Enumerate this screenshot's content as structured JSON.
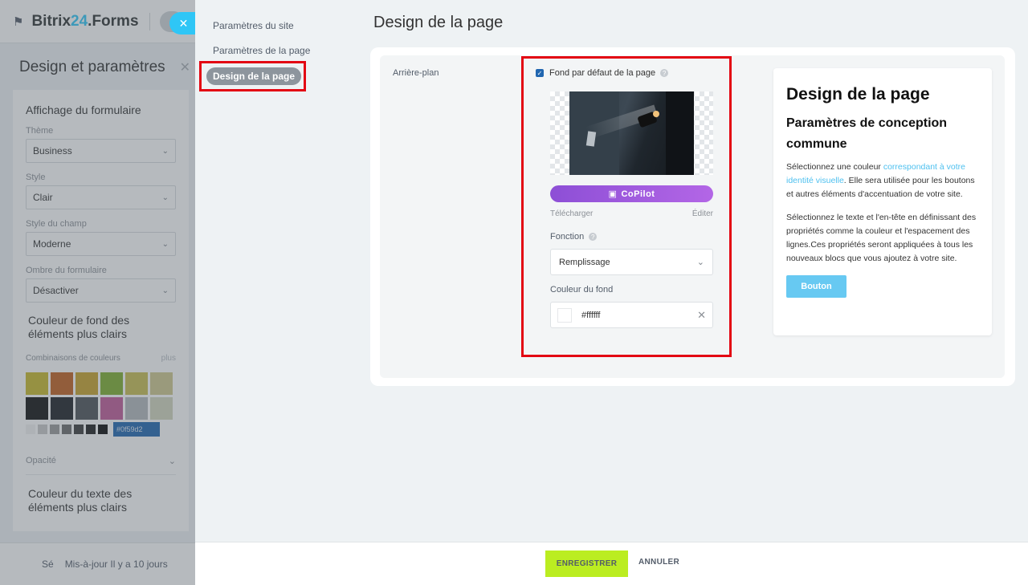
{
  "background": {
    "app_title_prefix": "Bitrix",
    "app_title_num": "24",
    "app_title_suffix": ".Forms",
    "panel_title": "Design et paramètres",
    "section_display": "Affichage du formulaire",
    "theme_label": "Thème",
    "theme_value": "Business",
    "style_label": "Style",
    "style_value": "Clair",
    "field_style_label": "Style du champ",
    "field_style_value": "Moderne",
    "shadow_label": "Ombre du formulaire",
    "shadow_value": "Désactiver",
    "bg_color_title": "Couleur de fond des éléments plus clairs",
    "combos_label": "Combinaisons de couleurs",
    "combos_plus": "plus",
    "swatch_colors": [
      "#c9b82a",
      "#c25f1e",
      "#c9a32a",
      "#7fae2e",
      "#c9be52",
      "#cfc98e",
      "#111111",
      "#1d2025",
      "#4c5157",
      "#c05b98",
      "#b4b8bc",
      "#d3d6bd"
    ],
    "mini_colors": [
      "#f2f2f2",
      "#c8c8c8",
      "#9a9a9a",
      "#6b6b6b",
      "#3c3c3c",
      "#1e1e1e",
      "#0a0a0a"
    ],
    "hex_chip": "#0f59d2",
    "opacity_label": "Opacité",
    "text_color_title": "Couleur du texte des éléments plus clairs",
    "footer_prefix": "Sé",
    "footer_text": "Mis-à-jour Il y a 10 jours"
  },
  "nav": {
    "items": [
      "Paramètres du site",
      "Paramètres de la page"
    ],
    "active": "Design de la page"
  },
  "page_title": "Design de la page",
  "form": {
    "row_label": "Arrière-plan",
    "checkbox_label": "Fond par défaut de la page",
    "copilot_label": "CoPilot",
    "upload_label": "Télécharger",
    "edit_label": "Éditer",
    "function_label": "Fonction",
    "function_value": "Remplissage",
    "bg_color_label": "Couleur du fond",
    "bg_color_value": "#ffffff"
  },
  "preview": {
    "title": "Design de la page",
    "subtitle": "Paramètres de conception commune",
    "p1_start": "Sélectionnez une couleur ",
    "p1_link": "correspondant à votre identité visuelle",
    "p1_end": ". Elle sera utilisée pour les boutons et autres éléments d'accentuation de votre site.",
    "p2": "Sélectionnez le texte et l'en-tête en définissant des propriétés comme la couleur et l'espacement des lignes.Ces propriétés seront appliquées à tous les nouveaux blocs que vous ajoutez à votre site.",
    "button": "Bouton"
  },
  "footer": {
    "save": "ENREGISTRER",
    "cancel": "ANNULER"
  },
  "colors": {
    "accent": "#2fc6f6",
    "highlight": "#e30613",
    "save_button": "#bbed21"
  }
}
